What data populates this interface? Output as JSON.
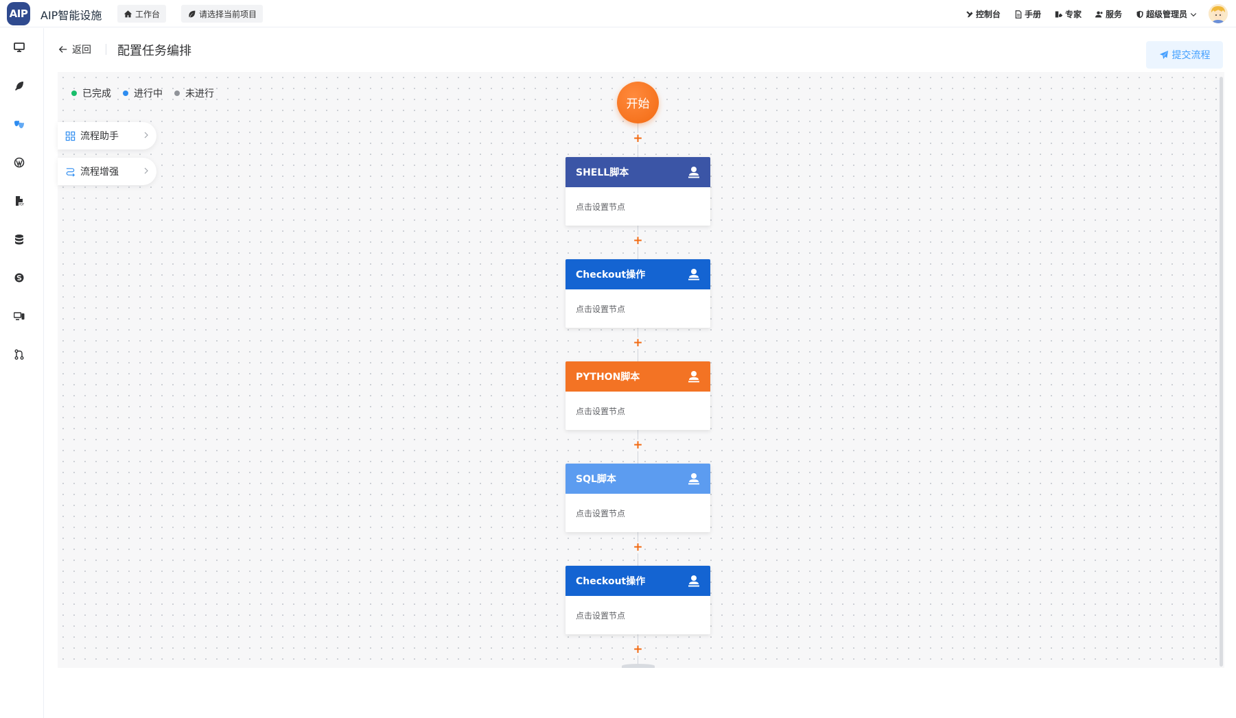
{
  "header": {
    "logo_text": "AIP",
    "app_title": "AIP智能设施",
    "tabs": [
      {
        "label": "工作台",
        "icon": "home-icon"
      },
      {
        "label": "请选择当前项目",
        "icon": "leaf-icon"
      }
    ],
    "right_menu": [
      {
        "label": "控制台",
        "icon": "tools-icon"
      },
      {
        "label": "手册",
        "icon": "document-icon"
      },
      {
        "label": "专家",
        "icon": "expert-icon"
      },
      {
        "label": "服务",
        "icon": "users-icon"
      },
      {
        "label": "超级管理员",
        "icon": "shield-icon"
      }
    ]
  },
  "sidebar": {
    "items": [
      {
        "icon": "monitor-icon"
      },
      {
        "icon": "feather-icon"
      },
      {
        "icon": "mask-icon",
        "active": true
      },
      {
        "icon": "wordpress-icon"
      },
      {
        "icon": "pdf-file-icon"
      },
      {
        "icon": "database-icon"
      },
      {
        "icon": "skype-icon"
      },
      {
        "icon": "devices-icon"
      },
      {
        "icon": "git-merge-icon"
      }
    ]
  },
  "page": {
    "back_label": "返回",
    "title": "配置任务编排",
    "submit_label": "提交流程"
  },
  "legend": [
    {
      "label": "已完成",
      "color": "#19be6b"
    },
    {
      "label": "进行中",
      "color": "#2d8cf0"
    },
    {
      "label": "未进行",
      "color": "#909399"
    }
  ],
  "helpers": [
    {
      "label": "流程助手",
      "icon": "grid-icon"
    },
    {
      "label": "流程增强",
      "icon": "flow-icon"
    }
  ],
  "flow": {
    "start_label": "开始",
    "add_symbol": "+",
    "nodes": [
      {
        "title": "SHELL脚本",
        "body": "点击设置节点",
        "color": "#3b55a6"
      },
      {
        "title": "Checkout操作",
        "body": "点击设置节点",
        "color": "#1464d2"
      },
      {
        "title": "PYTHON脚本",
        "body": "点击设置节点",
        "color": "#f37324"
      },
      {
        "title": "SQL脚本",
        "body": "点击设置节点",
        "color": "#5c9cf0"
      },
      {
        "title": "Checkout操作",
        "body": "点击设置节点",
        "color": "#1464d2"
      }
    ]
  }
}
